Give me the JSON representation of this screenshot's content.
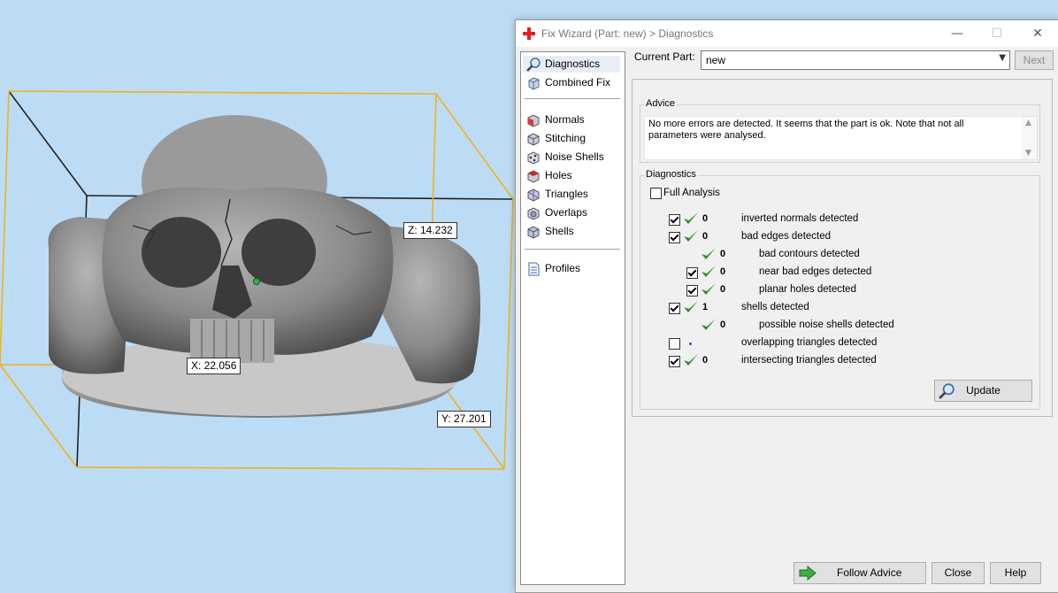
{
  "viewport": {
    "dimension_labels": {
      "z": "Z: 14.232",
      "x": "X: 22.056",
      "y": "Y: 27.201"
    },
    "colors": {
      "background": "#bcdcf6",
      "bounding_box": "#f2b01e",
      "model": "#8c8c8c"
    }
  },
  "dialog": {
    "title": "Fix Wizard (Part: new) > Diagnostics",
    "window_controls": {
      "minimize": "—",
      "maximize": "☐",
      "close": "✕"
    },
    "nav": {
      "items": [
        {
          "label": "Diagnostics",
          "icon": "magnifier-icon",
          "selected": true
        },
        {
          "label": "Combined Fix",
          "icon": "combined-fix-icon"
        },
        {
          "label": "Normals",
          "icon": "normals-cube-icon"
        },
        {
          "label": "Stitching",
          "icon": "stitching-cube-icon"
        },
        {
          "label": "Noise Shells",
          "icon": "noise-shells-icon"
        },
        {
          "label": "Holes",
          "icon": "holes-cube-icon"
        },
        {
          "label": "Triangles",
          "icon": "triangles-cube-icon"
        },
        {
          "label": "Overlaps",
          "icon": "overlaps-cube-icon"
        },
        {
          "label": "Shells",
          "icon": "shells-cube-icon"
        },
        {
          "label": "Profiles",
          "icon": "profiles-document-icon"
        }
      ]
    },
    "current_part": {
      "label": "Current Part:",
      "value": "new"
    },
    "next_button": "Next",
    "advice": {
      "title": "Advice",
      "text": "No more errors are detected. It seems that the part is ok. Note that not all parameters were analysed."
    },
    "diagnostics": {
      "title": "Diagnostics",
      "full_analysis_label": "Full Analysis",
      "full_analysis_checked": false,
      "rows": [
        {
          "checked": true,
          "status": "ok",
          "value": "0",
          "label": "inverted normals detected"
        },
        {
          "checked": true,
          "status": "ok",
          "value": "0",
          "label": "bad edges detected"
        },
        {
          "checked": null,
          "status": "ok",
          "value": "0",
          "label": "bad contours detected"
        },
        {
          "checked": true,
          "status": "ok",
          "value": "0",
          "label": "near bad edges detected"
        },
        {
          "checked": true,
          "status": "ok",
          "value": "0",
          "label": "planar holes detected"
        },
        {
          "checked": true,
          "status": "ok",
          "value": "1",
          "label": "shells detected"
        },
        {
          "checked": null,
          "status": "ok",
          "value": "0",
          "label": "possible noise shells detected"
        },
        {
          "checked": false,
          "status": "pending",
          "value": "",
          "label": "overlapping triangles detected"
        },
        {
          "checked": true,
          "status": "ok",
          "value": "0",
          "label": "intersecting triangles detected"
        }
      ],
      "update_button": "Update"
    },
    "footer": {
      "follow_advice": "Follow Advice",
      "close": "Close",
      "help": "Help"
    },
    "colors": {
      "check_green": "#2e8b2e",
      "arrow_green": "#3fae3f",
      "title_icon_red": "#e02020"
    }
  }
}
